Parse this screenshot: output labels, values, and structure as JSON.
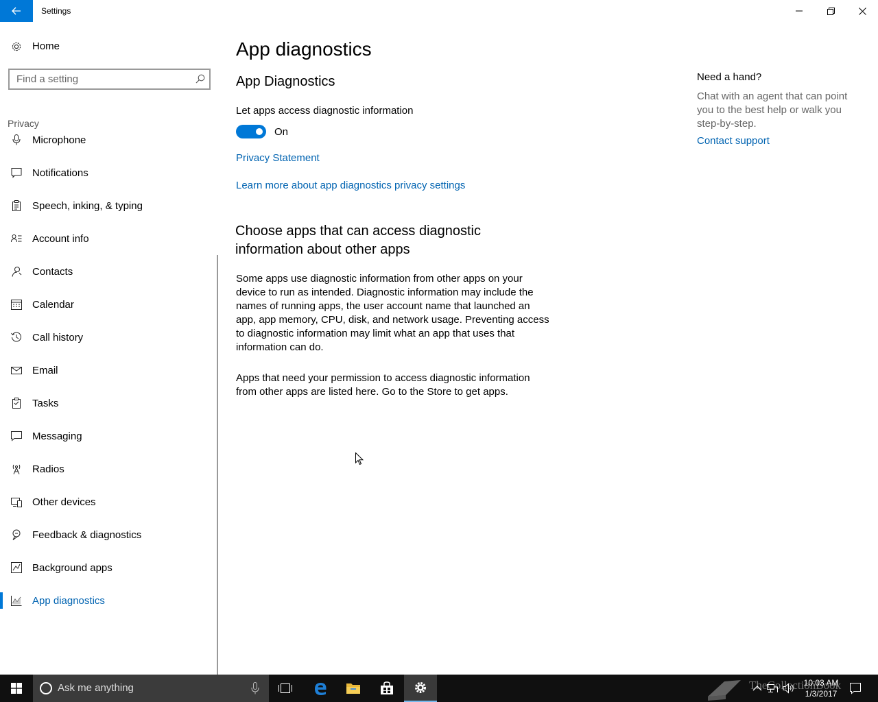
{
  "window": {
    "title": "Settings"
  },
  "sidebar": {
    "home_label": "Home",
    "search_placeholder": "Find a setting",
    "section_label": "Privacy",
    "items": [
      {
        "label": "Microphone",
        "icon": "microphone-icon"
      },
      {
        "label": "Notifications",
        "icon": "notification-icon"
      },
      {
        "label": "Speech, inking, & typing",
        "icon": "clipboard-icon"
      },
      {
        "label": "Account info",
        "icon": "account-info-icon"
      },
      {
        "label": "Contacts",
        "icon": "contacts-icon"
      },
      {
        "label": "Calendar",
        "icon": "calendar-icon"
      },
      {
        "label": "Call history",
        "icon": "history-icon"
      },
      {
        "label": "Email",
        "icon": "mail-icon"
      },
      {
        "label": "Tasks",
        "icon": "tasks-icon"
      },
      {
        "label": "Messaging",
        "icon": "message-icon"
      },
      {
        "label": "Radios",
        "icon": "radio-tower-icon"
      },
      {
        "label": "Other devices",
        "icon": "devices-icon"
      },
      {
        "label": "Feedback & diagnostics",
        "icon": "feedback-icon"
      },
      {
        "label": "Background apps",
        "icon": "background-apps-icon"
      },
      {
        "label": "App diagnostics",
        "icon": "diagnostics-chart-icon",
        "active": true
      }
    ]
  },
  "main": {
    "title": "App diagnostics",
    "section1_heading": "App Diagnostics",
    "toggle_label": "Let apps access diagnostic information",
    "toggle_state": "On",
    "privacy_link": "Privacy Statement",
    "learn_more_link": "Learn more about app diagnostics privacy settings",
    "section2_heading_line1": "Choose apps that can access diagnostic",
    "section2_heading_line2": "information about other apps",
    "paragraph1_lines": [
      "Some apps use diagnostic information from other apps on your",
      "device to run as intended. Diagnostic information may include the",
      "names of running apps, the user account name that launched an",
      "app, app memory, CPU, disk, and network usage. Preventing access",
      "to diagnostic information may limit what an app that uses that",
      "information can do."
    ],
    "paragraph2_lines": [
      "Apps that need your permission to access diagnostic information",
      "from other apps are listed here. Go to the Store to get apps."
    ]
  },
  "help": {
    "heading": "Need a hand?",
    "text_lines": [
      "Chat with an agent that can point",
      "you to the best help or walk you",
      "step-by-step."
    ],
    "link": "Contact support"
  },
  "taskbar": {
    "search_placeholder": "Ask me anything",
    "time": "10:03 AM",
    "date": "1/3/2017",
    "watermark": "TheCollectionBook"
  },
  "colors": {
    "accent": "#0078d7",
    "link": "#0063b1",
    "taskbar": "#101010"
  }
}
